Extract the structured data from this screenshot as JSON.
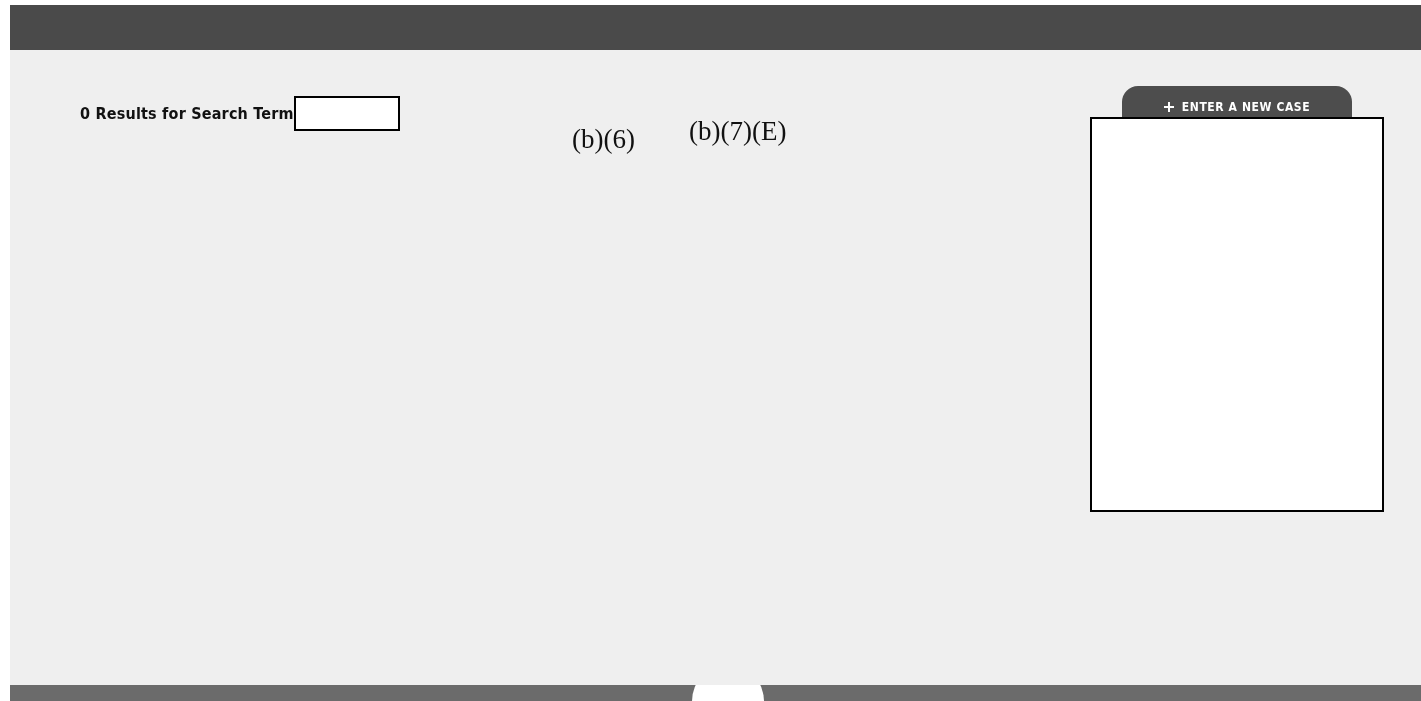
{
  "results": {
    "text": "0 Results for Search Term"
  },
  "redaction_codes": [
    "(b)(6)",
    "(b)(7)(E)"
  ],
  "new_case_button": {
    "label": "ENTER A NEW CASE"
  }
}
